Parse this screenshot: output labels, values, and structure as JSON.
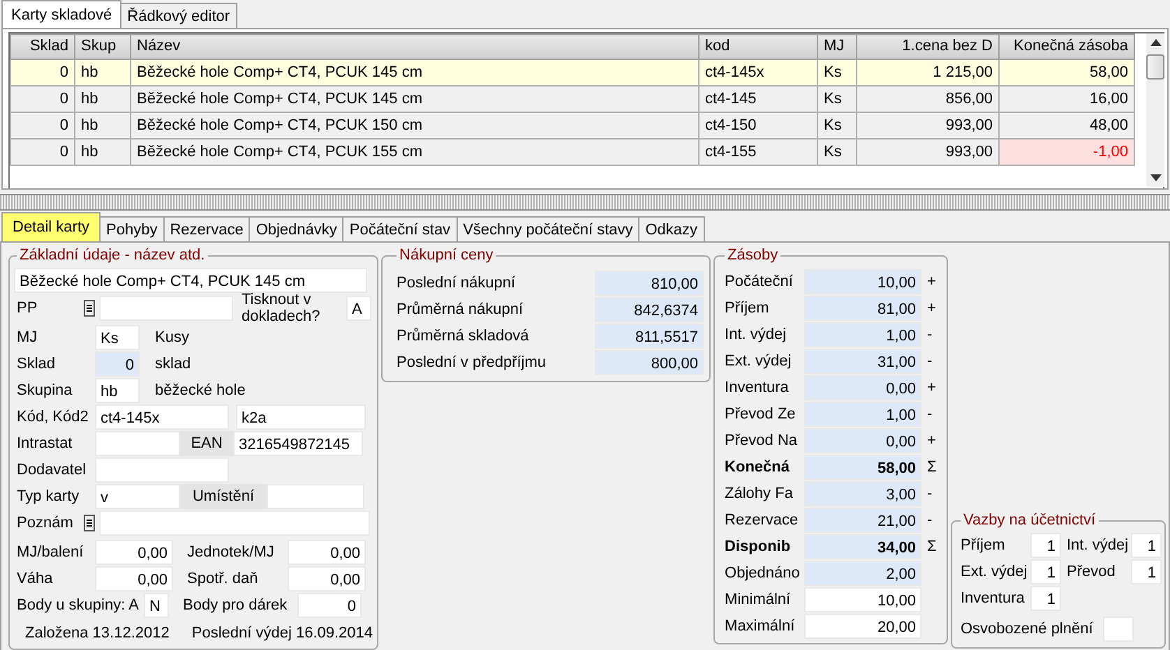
{
  "top_tabs": [
    {
      "label": "Karty skladové",
      "selected": true
    },
    {
      "label": "Řádkový editor",
      "selected": false
    }
  ],
  "grid": {
    "columns": [
      {
        "label": "Sklad",
        "kind": "number"
      },
      {
        "label": "Skup",
        "kind": "text"
      },
      {
        "label": "Název",
        "kind": "text"
      },
      {
        "label": "kod",
        "kind": "text"
      },
      {
        "label": "MJ",
        "kind": "text"
      },
      {
        "label": "1.cena bez D",
        "kind": "number"
      },
      {
        "label": "Konečná zásoba",
        "kind": "number"
      }
    ],
    "rows": [
      {
        "cells": [
          "0",
          "hb",
          "Běžecké hole Comp+ CT4, PCUK 145 cm",
          "ct4-145x",
          "Ks",
          "1 215,00",
          "58,00"
        ],
        "selected": true,
        "warning": false
      },
      {
        "cells": [
          "0",
          "hb",
          "Běžecké hole Comp+ CT4, PCUK 145 cm",
          "ct4-145",
          "Ks",
          "856,00",
          "16,00"
        ],
        "selected": false,
        "warning": false
      },
      {
        "cells": [
          "0",
          "hb",
          "Běžecké hole Comp+ CT4, PCUK 150 cm",
          "ct4-150",
          "Ks",
          "993,00",
          "48,00"
        ],
        "selected": false,
        "warning": false
      },
      {
        "cells": [
          "0",
          "hb",
          "Běžecké hole Comp+ CT4, PCUK 155 cm",
          "ct4-155",
          "Ks",
          "993,00",
          "-1,00"
        ],
        "selected": false,
        "warning": true
      }
    ]
  },
  "detail_tabs": [
    {
      "label": "Detail karty",
      "selected": true
    },
    {
      "label": "Pohyby",
      "selected": false
    },
    {
      "label": "Rezervace",
      "selected": false
    },
    {
      "label": "Objednávky",
      "selected": false
    },
    {
      "label": "Počáteční stav",
      "selected": false
    },
    {
      "label": "Všechny počáteční stavy",
      "selected": false
    },
    {
      "label": "Odkazy",
      "selected": false
    }
  ],
  "basic": {
    "title": "Základní údaje - název atd.",
    "name": "Běžecké hole Comp+ CT4, PCUK 145 cm",
    "pp_label": "PP",
    "print_label": "Tisknout v dokladech?",
    "print_value": "A",
    "mj_label": "MJ",
    "mj_value": "Ks",
    "mj_name": "Kusy",
    "sklad_label": "Sklad",
    "sklad_value": "0",
    "sklad_name": "sklad",
    "skupina_label": "Skupina",
    "skupina_value": "hb",
    "skupina_name": "běžecké hole",
    "kod_label": "Kód, Kód2",
    "kod_value": "ct4-145x",
    "kod2_value": "k2a",
    "intrastat_label": "Intrastat",
    "ean_label": "EAN",
    "ean_value": "3216549872145",
    "dodavatel_label": "Dodavatel",
    "typ_label": "Typ karty",
    "typ_value": "v",
    "umisteni_label": "Umístění",
    "poznam_label": "Poznám",
    "mj_baleni_label": "MJ/balení",
    "mj_baleni_value": "0,00",
    "jednotek_label": "Jednotek/MJ",
    "jednotek_value": "0,00",
    "vaha_label": "Váha",
    "vaha_value": "0,00",
    "spotr_label": "Spotř. daň",
    "spotr_value": "0,00",
    "body_label": "Body u skupiny: A",
    "body_value": "N",
    "darek_label": "Body pro dárek",
    "darek_value": "0",
    "created": "Založena 13.12.2012",
    "last_issue": "Poslední výdej 16.09.2014"
  },
  "prices": {
    "title": "Nákupní ceny",
    "rows": [
      {
        "label": "Poslední nákupní",
        "value": "810,00"
      },
      {
        "label": "Průměrná nákupní",
        "value": "842,6374"
      },
      {
        "label": "Průměrná skladová",
        "value": "811,5517"
      },
      {
        "label": "Poslední v předpříjmu",
        "value": "800,00"
      }
    ]
  },
  "stock": {
    "title": "Zásoby",
    "rows": [
      {
        "label": "Počáteční",
        "value": "10,00",
        "sign": "+",
        "kind": "calc"
      },
      {
        "label": "Příjem",
        "value": "81,00",
        "sign": "+",
        "kind": "calc"
      },
      {
        "label": "Int. výdej",
        "value": "1,00",
        "sign": "-",
        "kind": "calc"
      },
      {
        "label": "Ext. výdej",
        "value": "31,00",
        "sign": "-",
        "kind": "calc"
      },
      {
        "label": "Inventura",
        "value": "0,00",
        "sign": "+",
        "kind": "calc"
      },
      {
        "label": "Převod Ze",
        "value": "1,00",
        "sign": "-",
        "kind": "calc"
      },
      {
        "label": "Převod Na",
        "value": "0,00",
        "sign": "+",
        "kind": "calc"
      },
      {
        "label": "Konečná",
        "value": "58,00",
        "sign": "Σ",
        "kind": "total"
      },
      {
        "label": "Zálohy Fa",
        "value": "3,00",
        "sign": "-",
        "kind": "calc"
      },
      {
        "label": "Rezervace",
        "value": "21,00",
        "sign": "-",
        "kind": "calc"
      },
      {
        "label": "Disponib",
        "value": "34,00",
        "sign": "Σ",
        "kind": "total"
      },
      {
        "label": "Objednáno",
        "value": "2,00",
        "kind": "calc"
      },
      {
        "label": "Minimální",
        "value": "10,00",
        "kind": "input"
      },
      {
        "label": "Maximální",
        "value": "20,00",
        "kind": "input"
      }
    ]
  },
  "accounting": {
    "title": "Vazby na účetnictví",
    "pairs": [
      {
        "label": "Příjem",
        "value": "1"
      },
      {
        "label": "Int. výdej",
        "value": "1"
      },
      {
        "label": "Ext. výdej",
        "value": "1"
      },
      {
        "label": "Převod",
        "value": "1"
      },
      {
        "label": "Inventura",
        "value": "1"
      }
    ],
    "exempt_label": "Osvobozené plnění"
  }
}
